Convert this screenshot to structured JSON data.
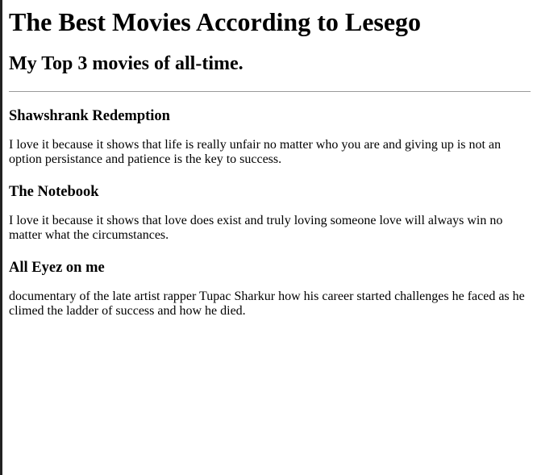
{
  "page": {
    "title": "The Best Movies According to Lesego",
    "subtitle": "My Top 3 movies of all-time."
  },
  "movies": [
    {
      "title": "Shawshrank Redemption",
      "description": "I love it because it shows that life is really unfair no matter who you are and giving up is not an option persistance and patience is the key to success."
    },
    {
      "title": "The Notebook",
      "description": "I love it because it shows that love does exist and truly loving someone love will always win no matter what the circumstances."
    },
    {
      "title": "All Eyez on me",
      "description": "documentary of the late artist rapper Tupac Sharkur how his career started challenges he faced as he climed the ladder of success and how he died."
    }
  ]
}
